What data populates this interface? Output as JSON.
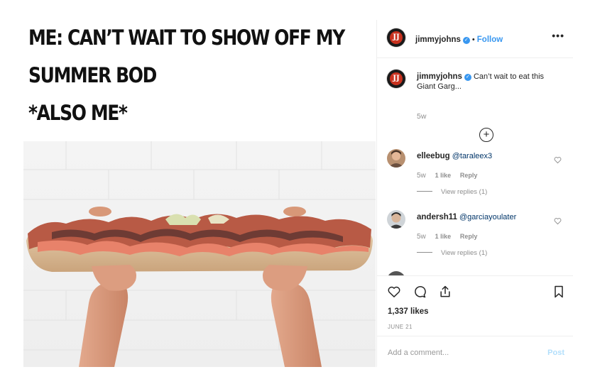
{
  "meme": {
    "line1": "ME: CAN’T WAIT TO SHOW OFF MY",
    "line2": "SUMMER BOD",
    "line3": "*ALSO ME*"
  },
  "post": {
    "username": "jimmyjohns",
    "follow_label": "Follow",
    "separator": "•",
    "more_label": "•••",
    "brand_badge": "JJ",
    "caption_username": "jimmyjohns",
    "caption_text": "Can’t wait to eat this Giant Garg...",
    "caption_time": "5w",
    "load_more_symbol": "+",
    "likes": "1,337 likes",
    "date": "JUNE 21",
    "add_comment_placeholder": "Add a comment...",
    "post_label": "Post"
  },
  "comments": [
    {
      "username": "elleebug",
      "mention": "@taraleex3",
      "time": "5w",
      "likes": "1 like",
      "reply": "Reply",
      "view_replies": "View replies (1)"
    },
    {
      "username": "andersh11",
      "mention": "@garciayoulater",
      "time": "5w",
      "likes": "1 like",
      "reply": "Reply",
      "view_replies": "View replies (1)"
    }
  ],
  "icons": [
    "heart-icon",
    "comment-icon",
    "share-icon",
    "bookmark-icon",
    "more-options-icon",
    "verified-badge-icon",
    "load-more-comments-icon"
  ],
  "colors": {
    "link_blue": "#3897f0",
    "brand_red": "#c8321f",
    "muted": "#8e8e8e"
  }
}
